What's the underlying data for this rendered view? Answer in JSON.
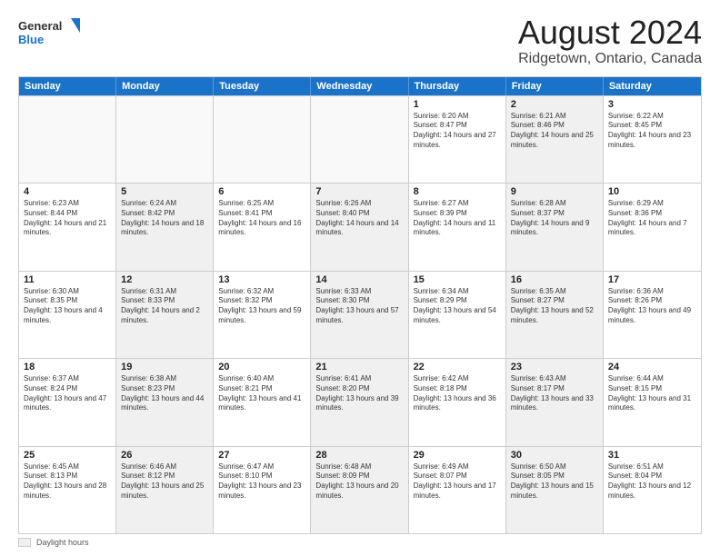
{
  "header": {
    "logo_line1": "General",
    "logo_line2": "Blue",
    "main_title": "August 2024",
    "subtitle": "Ridgetown, Ontario, Canada"
  },
  "calendar": {
    "days_of_week": [
      "Sunday",
      "Monday",
      "Tuesday",
      "Wednesday",
      "Thursday",
      "Friday",
      "Saturday"
    ],
    "weeks": [
      [
        {
          "day": "",
          "empty": true,
          "shaded": false
        },
        {
          "day": "",
          "empty": true,
          "shaded": false
        },
        {
          "day": "",
          "empty": true,
          "shaded": false
        },
        {
          "day": "",
          "empty": true,
          "shaded": false
        },
        {
          "day": "1",
          "sunrise": "6:20 AM",
          "sunset": "8:47 PM",
          "daylight": "14 hours and 27 minutes.",
          "shaded": false
        },
        {
          "day": "2",
          "sunrise": "6:21 AM",
          "sunset": "8:46 PM",
          "daylight": "14 hours and 25 minutes.",
          "shaded": true
        },
        {
          "day": "3",
          "sunrise": "6:22 AM",
          "sunset": "8:45 PM",
          "daylight": "14 hours and 23 minutes.",
          "shaded": false
        }
      ],
      [
        {
          "day": "4",
          "sunrise": "6:23 AM",
          "sunset": "8:44 PM",
          "daylight": "14 hours and 21 minutes.",
          "shaded": false
        },
        {
          "day": "5",
          "sunrise": "6:24 AM",
          "sunset": "8:42 PM",
          "daylight": "14 hours and 18 minutes.",
          "shaded": true
        },
        {
          "day": "6",
          "sunrise": "6:25 AM",
          "sunset": "8:41 PM",
          "daylight": "14 hours and 16 minutes.",
          "shaded": false
        },
        {
          "day": "7",
          "sunrise": "6:26 AM",
          "sunset": "8:40 PM",
          "daylight": "14 hours and 14 minutes.",
          "shaded": true
        },
        {
          "day": "8",
          "sunrise": "6:27 AM",
          "sunset": "8:39 PM",
          "daylight": "14 hours and 11 minutes.",
          "shaded": false
        },
        {
          "day": "9",
          "sunrise": "6:28 AM",
          "sunset": "8:37 PM",
          "daylight": "14 hours and 9 minutes.",
          "shaded": true
        },
        {
          "day": "10",
          "sunrise": "6:29 AM",
          "sunset": "8:36 PM",
          "daylight": "14 hours and 7 minutes.",
          "shaded": false
        }
      ],
      [
        {
          "day": "11",
          "sunrise": "6:30 AM",
          "sunset": "8:35 PM",
          "daylight": "13 hours and 4 minutes.",
          "shaded": false
        },
        {
          "day": "12",
          "sunrise": "6:31 AM",
          "sunset": "8:33 PM",
          "daylight": "14 hours and 2 minutes.",
          "shaded": true
        },
        {
          "day": "13",
          "sunrise": "6:32 AM",
          "sunset": "8:32 PM",
          "daylight": "13 hours and 59 minutes.",
          "shaded": false
        },
        {
          "day": "14",
          "sunrise": "6:33 AM",
          "sunset": "8:30 PM",
          "daylight": "13 hours and 57 minutes.",
          "shaded": true
        },
        {
          "day": "15",
          "sunrise": "6:34 AM",
          "sunset": "8:29 PM",
          "daylight": "13 hours and 54 minutes.",
          "shaded": false
        },
        {
          "day": "16",
          "sunrise": "6:35 AM",
          "sunset": "8:27 PM",
          "daylight": "13 hours and 52 minutes.",
          "shaded": true
        },
        {
          "day": "17",
          "sunrise": "6:36 AM",
          "sunset": "8:26 PM",
          "daylight": "13 hours and 49 minutes.",
          "shaded": false
        }
      ],
      [
        {
          "day": "18",
          "sunrise": "6:37 AM",
          "sunset": "8:24 PM",
          "daylight": "13 hours and 47 minutes.",
          "shaded": false
        },
        {
          "day": "19",
          "sunrise": "6:38 AM",
          "sunset": "8:23 PM",
          "daylight": "13 hours and 44 minutes.",
          "shaded": true
        },
        {
          "day": "20",
          "sunrise": "6:40 AM",
          "sunset": "8:21 PM",
          "daylight": "13 hours and 41 minutes.",
          "shaded": false
        },
        {
          "day": "21",
          "sunrise": "6:41 AM",
          "sunset": "8:20 PM",
          "daylight": "13 hours and 39 minutes.",
          "shaded": true
        },
        {
          "day": "22",
          "sunrise": "6:42 AM",
          "sunset": "8:18 PM",
          "daylight": "13 hours and 36 minutes.",
          "shaded": false
        },
        {
          "day": "23",
          "sunrise": "6:43 AM",
          "sunset": "8:17 PM",
          "daylight": "13 hours and 33 minutes.",
          "shaded": true
        },
        {
          "day": "24",
          "sunrise": "6:44 AM",
          "sunset": "8:15 PM",
          "daylight": "13 hours and 31 minutes.",
          "shaded": false
        }
      ],
      [
        {
          "day": "25",
          "sunrise": "6:45 AM",
          "sunset": "8:13 PM",
          "daylight": "13 hours and 28 minutes.",
          "shaded": false
        },
        {
          "day": "26",
          "sunrise": "6:46 AM",
          "sunset": "8:12 PM",
          "daylight": "13 hours and 25 minutes.",
          "shaded": true
        },
        {
          "day": "27",
          "sunrise": "6:47 AM",
          "sunset": "8:10 PM",
          "daylight": "13 hours and 23 minutes.",
          "shaded": false
        },
        {
          "day": "28",
          "sunrise": "6:48 AM",
          "sunset": "8:09 PM",
          "daylight": "13 hours and 20 minutes.",
          "shaded": true
        },
        {
          "day": "29",
          "sunrise": "6:49 AM",
          "sunset": "8:07 PM",
          "daylight": "13 hours and 17 minutes.",
          "shaded": false
        },
        {
          "day": "30",
          "sunrise": "6:50 AM",
          "sunset": "8:05 PM",
          "daylight": "13 hours and 15 minutes.",
          "shaded": true
        },
        {
          "day": "31",
          "sunrise": "6:51 AM",
          "sunset": "8:04 PM",
          "daylight": "13 hours and 12 minutes.",
          "shaded": false
        }
      ]
    ]
  },
  "footer": {
    "shaded_label": "Daylight hours"
  }
}
